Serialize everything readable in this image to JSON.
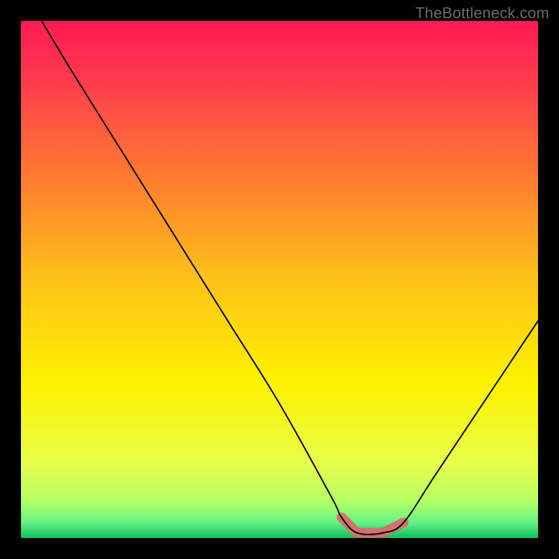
{
  "watermark": "TheBottleneck.com",
  "chart_data": {
    "type": "line",
    "title": "",
    "xlabel": "",
    "ylabel": "",
    "xlim": [
      0,
      100
    ],
    "ylim": [
      0,
      100
    ],
    "grid": false,
    "legend": false,
    "series": [
      {
        "name": "bottleneck-curve",
        "x": [
          4,
          10,
          20,
          30,
          40,
          50,
          60,
          62,
          65,
          70,
          74,
          80,
          90,
          100
        ],
        "values": [
          100,
          90,
          74,
          58,
          42,
          26,
          8,
          4,
          1,
          1,
          3,
          12,
          27,
          42
        ]
      }
    ],
    "annotations": [
      {
        "name": "floor-highlight",
        "xrange": [
          62,
          74
        ],
        "color": "#d86d6d"
      }
    ],
    "background_gradient": {
      "stops": [
        {
          "offset": 0.0,
          "color": "#ff1a55"
        },
        {
          "offset": 0.12,
          "color": "#ff3d4d"
        },
        {
          "offset": 0.3,
          "color": "#ff7a30"
        },
        {
          "offset": 0.5,
          "color": "#ffc21a"
        },
        {
          "offset": 0.7,
          "color": "#fef200"
        },
        {
          "offset": 0.86,
          "color": "#e6ff4d"
        },
        {
          "offset": 0.93,
          "color": "#b3ff66"
        },
        {
          "offset": 0.97,
          "color": "#66f285"
        },
        {
          "offset": 1.0,
          "color": "#0dbf5a"
        }
      ]
    }
  }
}
